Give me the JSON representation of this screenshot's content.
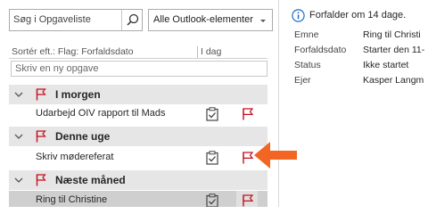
{
  "search": {
    "placeholder": "Søg i Opgaveliste",
    "scope": "Alle Outlook-elementer"
  },
  "list_header": {
    "sort_label": "Sortér eft.: Flag: Forfaldsdato",
    "today_label": "I dag"
  },
  "new_task": {
    "placeholder": "Skriv en ny opgave"
  },
  "groups": [
    {
      "label": "I morgen",
      "tasks": [
        {
          "title": "Udarbejd OIV rapport til Mads"
        }
      ]
    },
    {
      "label": "Denne uge",
      "tasks": [
        {
          "title": "Skriv mødereferat"
        }
      ]
    },
    {
      "label": "Næste måned",
      "tasks": [
        {
          "title": "Ring til Christine",
          "selected": true
        }
      ]
    }
  ],
  "details": {
    "info_banner": "Forfalder om 14 dage.",
    "properties": [
      {
        "label": "Emne",
        "value": "Ring til Christi"
      },
      {
        "label": "Forfaldsdato",
        "value": "Starter den 11-"
      },
      {
        "label": "Status",
        "value": "Ikke startet"
      },
      {
        "label": "Ejer",
        "value": "Kasper Langm"
      }
    ]
  },
  "colors": {
    "flag_red": "#c50f1f",
    "arrow_orange": "#f26522",
    "info_blue": "#1e6fc2",
    "group_bg": "#e6e6e6",
    "selected_bg": "#cfcfcf"
  }
}
